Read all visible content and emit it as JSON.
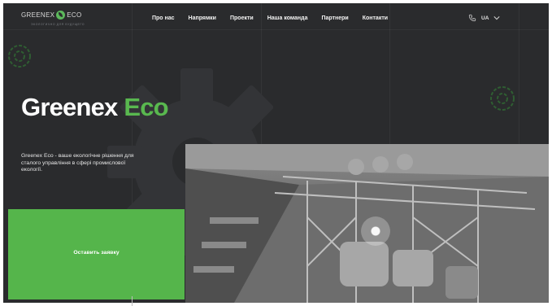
{
  "brand": {
    "name_left": "GREENEX",
    "name_right": "ECO",
    "tagline": "ЭКОЛОГИЧНО ДЛЯ БУДУЩЕГО"
  },
  "nav": {
    "items": [
      "Про нас",
      "Напрямки",
      "Проекти",
      "Наша команда",
      "Партнери",
      "Контакти"
    ]
  },
  "header": {
    "lang": "UA"
  },
  "hero": {
    "title_main": "Greenex",
    "title_accent": "Eco",
    "description": "Greenex Eco - ваше екологічне рішення для сталого управління в сфері промислової екології."
  },
  "cta": {
    "label": "Оставить заявку"
  },
  "colors": {
    "background": "#2a2b2d",
    "accent": "#55b54b",
    "text": "#ffffff"
  }
}
